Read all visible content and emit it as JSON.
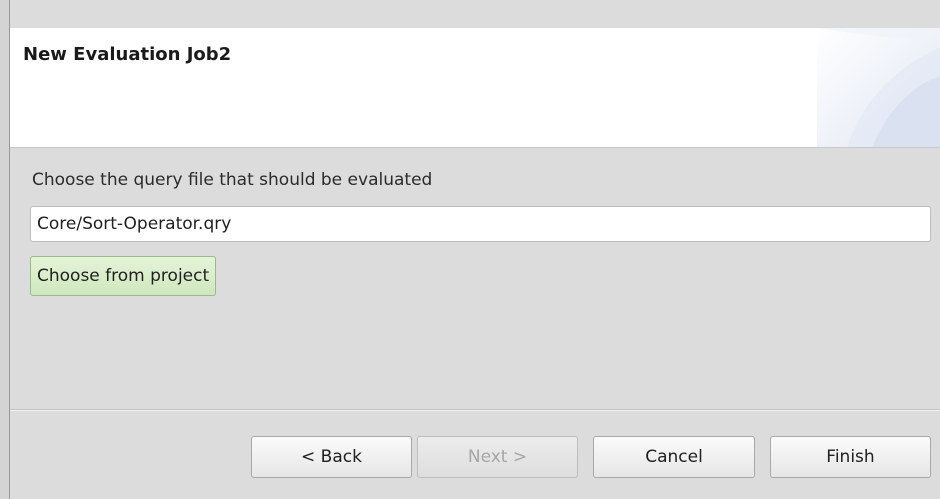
{
  "wizard": {
    "title": "New Evaluation Job2"
  },
  "query": {
    "label": "Choose the query file that should be evaluated",
    "value": "Core/Sort-Operator.qry",
    "choose_button": "Choose from project"
  },
  "buttons": {
    "back": "< Back",
    "next": "Next >",
    "cancel": "Cancel",
    "finish": "Finish"
  },
  "state": {
    "next_enabled": false
  }
}
